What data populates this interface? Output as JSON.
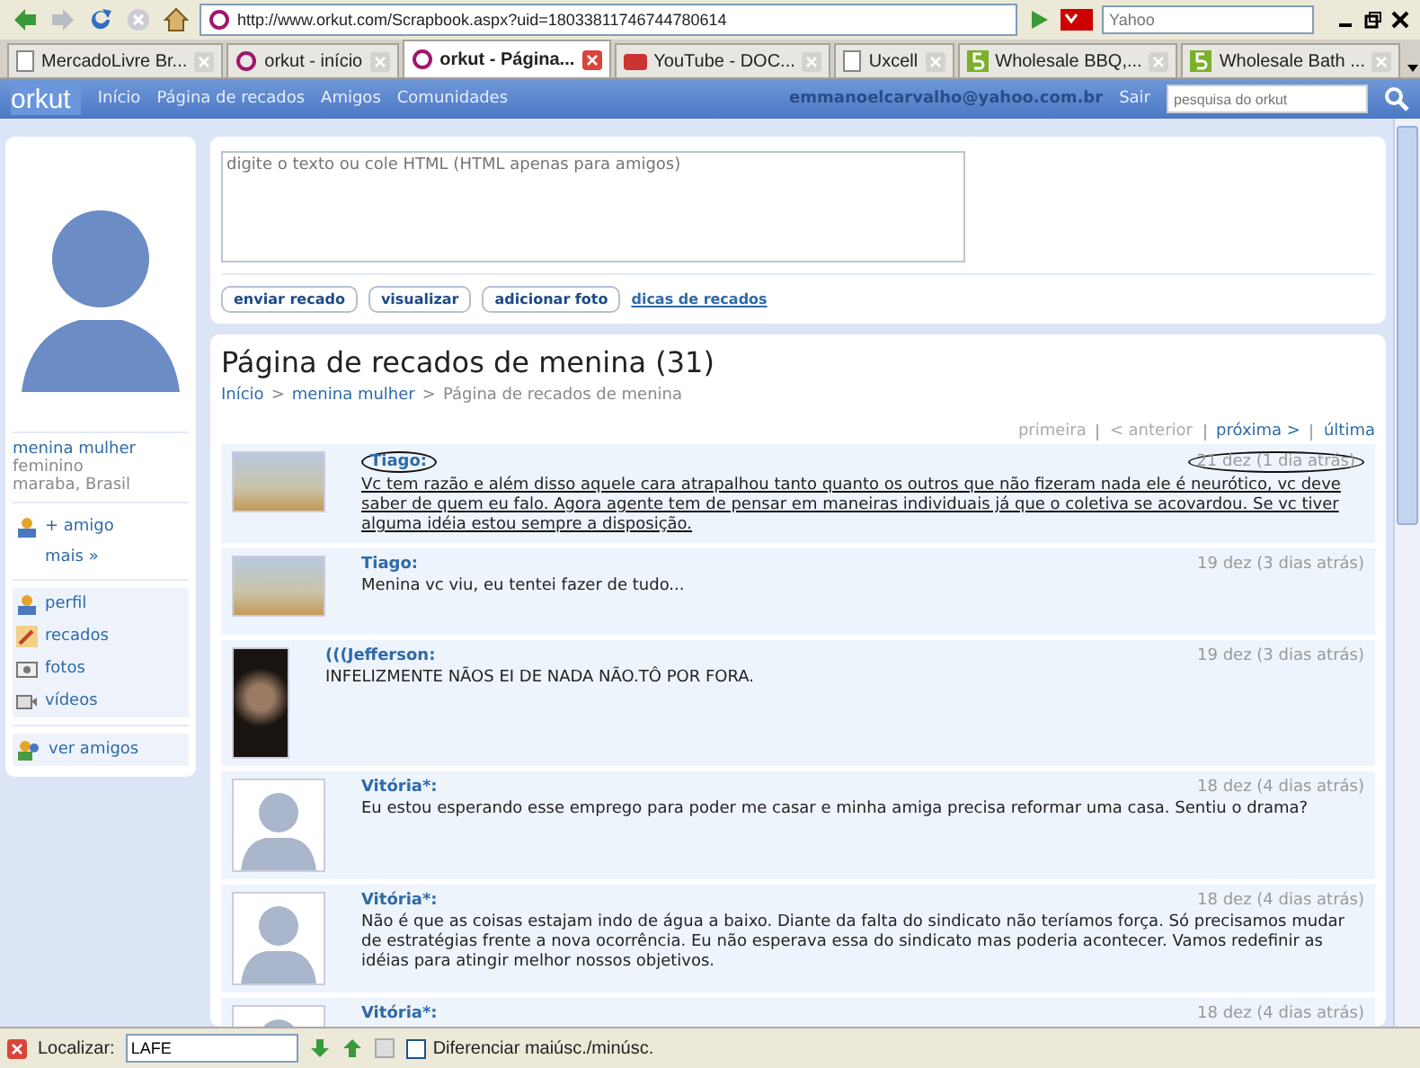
{
  "browser": {
    "url": "http://www.orkut.com/Scrapbook.aspx?uid=18033811746744780614",
    "search_placeholder": "Yahoo"
  },
  "tabs": [
    {
      "label": "MercadoLivre Br...",
      "kind": "page",
      "selected": false
    },
    {
      "label": "orkut - início",
      "kind": "orkut",
      "selected": false
    },
    {
      "label": "orkut - Página...",
      "kind": "orkut",
      "selected": true
    },
    {
      "label": "YouTube - DOC...",
      "kind": "youtube",
      "selected": false
    },
    {
      "label": "Uxcell",
      "kind": "page",
      "selected": false
    },
    {
      "label": "Wholesale BBQ,...",
      "kind": "five",
      "selected": false
    },
    {
      "label": "Wholesale Bath ...",
      "kind": "five",
      "selected": false
    }
  ],
  "nav": {
    "logo": "orkut",
    "links": [
      "Início",
      "Página de recados",
      "Amigos",
      "Comunidades"
    ],
    "email": "emmanoelcarvalho@yahoo.com.br",
    "logout": "Sair",
    "search_placeholder": "pesquisa do orkut"
  },
  "profile": {
    "name": "menina mulher",
    "gender": "feminino",
    "location": "maraba, Brasil",
    "add_friend": "+ amigo",
    "more": "mais »",
    "menu": [
      {
        "label": "perfil",
        "kind": "person"
      },
      {
        "label": "recados",
        "kind": "pencil"
      },
      {
        "label": "fotos",
        "kind": "photo"
      },
      {
        "label": "vídeos",
        "kind": "video"
      }
    ],
    "friends": "ver amigos"
  },
  "composer": {
    "placeholder": "digite o texto ou cole HTML (HTML apenas para amigos)",
    "buttons": [
      "enviar recado",
      "visualizar",
      "adicionar foto"
    ],
    "tips": "dicas de recados"
  },
  "scrapbook": {
    "title": "Página de recados de menina (31)",
    "breadcrumb": [
      "Início",
      ">",
      "menina mulher",
      ">",
      "Página de recados de menina"
    ],
    "pager": [
      {
        "label": "primeira",
        "disabled": true
      },
      {
        "label": "< anterior",
        "disabled": true
      },
      {
        "label": "próxima >",
        "disabled": false
      },
      {
        "label": "última",
        "disabled": false
      }
    ],
    "scraps": [
      {
        "author": "Tiago:",
        "kind": "photo",
        "date": "21 dez (1 dia atrás)",
        "text": "Vc tem razão e além disso aquele cara atrapalhou tanto quanto os outros que não fizeram nada ele é neurótico, vc deve saber de quem eu falo. Agora agente tem de pensar em maneiras individuais já que o coletiva se acovardou. Se vc tiver alguma idéia estou sempre a disposição.",
        "marked": true
      },
      {
        "author": "Tiago:",
        "kind": "photo",
        "date": "19 dez (3 dias atrás)",
        "text": "Menina vc viu, eu tentei fazer de tudo...",
        "marked": false
      },
      {
        "author": "(((Jefferson:",
        "kind": "portrait",
        "date": "19 dez (3 dias atrás)",
        "text": "INFELIZMENTE NÃOS EI DE NADA NÃO.TÔ POR FORA.",
        "marked": false
      },
      {
        "author": "Vitória*:",
        "kind": "silhouette",
        "date": "18 dez (4 dias atrás)",
        "text": "Eu estou esperando esse emprego para poder me casar e minha amiga precisa reformar uma casa. Sentiu o drama?",
        "marked": false
      },
      {
        "author": "Vitória*:",
        "kind": "silhouette",
        "date": "18 dez (4 dias atrás)",
        "text": "Não é que as coisas estajam indo de água a baixo. Diante da falta do sindicato não teríamos força. Só precisamos mudar de estratégias frente a nova ocorrência. Eu não esperava essa do sindicato mas poderia acontecer. Vamos redefinir as idéias para atingir melhor nossos objetivos.",
        "marked": false
      },
      {
        "author": "Vitória*:",
        "kind": "silhouette",
        "date": "18 dez (4 dias atrás)",
        "marked": false
      }
    ]
  },
  "findbar": {
    "label": "Localizar:",
    "value": "LAFE",
    "match_case": {
      "label": "Diferenciar maiúsc./minúsc.",
      "checked": false
    }
  }
}
